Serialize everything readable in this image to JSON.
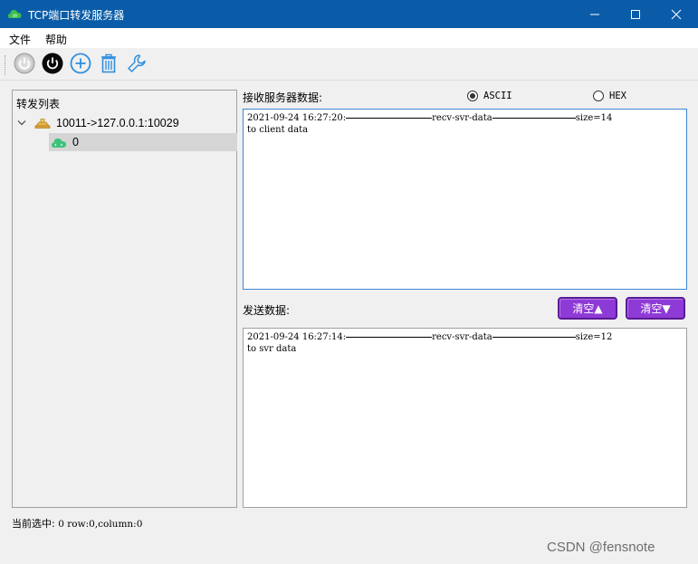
{
  "window": {
    "title": "TCP端口转发服务器",
    "app_icon": "green-cloud-app-icon"
  },
  "menu": {
    "items": [
      "文件",
      "帮助"
    ]
  },
  "toolbar": {
    "buttons": [
      "power-disabled-icon",
      "power-icon",
      "add-icon",
      "trash-icon",
      "wrench-icon"
    ]
  },
  "tree": {
    "header": "转发列表",
    "parent": {
      "label": "10011->127.0.0.1:10029",
      "icon": "server-icon"
    },
    "child": {
      "label": "0",
      "icon": "connection-icon",
      "selected": true
    }
  },
  "recv": {
    "label": "接收服务器数据:",
    "mode_options": [
      "ASCII",
      "HEX"
    ],
    "selected_mode": "ASCII",
    "log": {
      "timestamp": "2021-09-24 16:27:20:",
      "tag": "recv-svr-data",
      "size": "size=14",
      "body": "to client data"
    }
  },
  "send": {
    "label": "发送数据:",
    "clear_up": "清空▲",
    "clear_down": "清空▼",
    "log": {
      "timestamp": "2021-09-24 16:27:14:",
      "tag": "recv-svr-data",
      "size": "size=12",
      "body": "to svr data"
    }
  },
  "status": {
    "prefix": "当前选中:",
    "value": "0 row:0,column:0"
  },
  "watermark": "CSDN @fensnote",
  "colors": {
    "titlebar": "#0a5ca8",
    "clear_button": "#8e3ad6",
    "recv_border": "#3c86d6"
  }
}
